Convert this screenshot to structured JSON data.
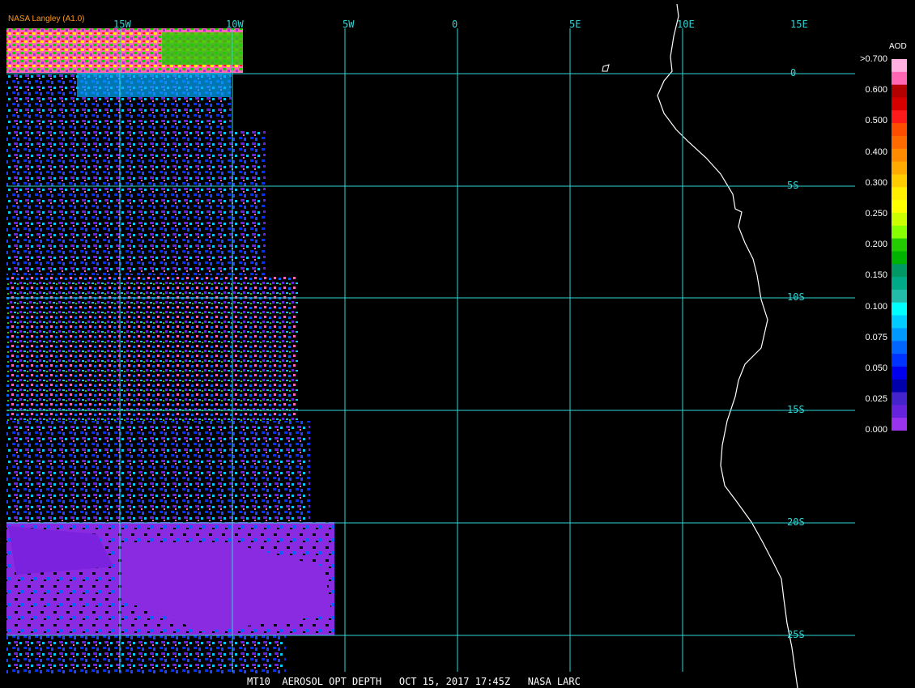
{
  "credit": "NASA Langley (A1.0)",
  "footer": "MT10  AEROSOL OPT DEPTH   OCT 15, 2017 17:45Z   NASA LARC",
  "longitudes": [
    "15W",
    "10W",
    "5W",
    "0",
    "5E",
    "10E",
    "15E"
  ],
  "latitudes": [
    "0",
    "5S",
    "10S",
    "15S",
    "20S",
    "25S"
  ],
  "legend": {
    "title": "AOD",
    "labels": [
      ">0.700",
      "0.600",
      "0.500",
      "0.400",
      "0.300",
      "0.250",
      "0.200",
      "0.150",
      "0.100",
      "0.075",
      "0.050",
      "0.025",
      "0.000"
    ],
    "colors": [
      "#ffb0e0",
      "#ff66b3",
      "#b30000",
      "#d60000",
      "#ff1a1a",
      "#ff4d00",
      "#ff6a00",
      "#ff8c00",
      "#ffaa00",
      "#ffcc00",
      "#ffee00",
      "#ffff00",
      "#ccff00",
      "#88ff00",
      "#22cc00",
      "#00b300",
      "#009966",
      "#00aa88",
      "#22bbaa",
      "#00ffff",
      "#00ccff",
      "#0099ff",
      "#0066ff",
      "#0033ff",
      "#0000ee",
      "#0000aa",
      "#4422cc",
      "#6622dd",
      "#9933ee"
    ]
  },
  "colors": {
    "grid": "#2fd6d6",
    "coast": "#ffffff",
    "credit": "#ff9a1f"
  }
}
